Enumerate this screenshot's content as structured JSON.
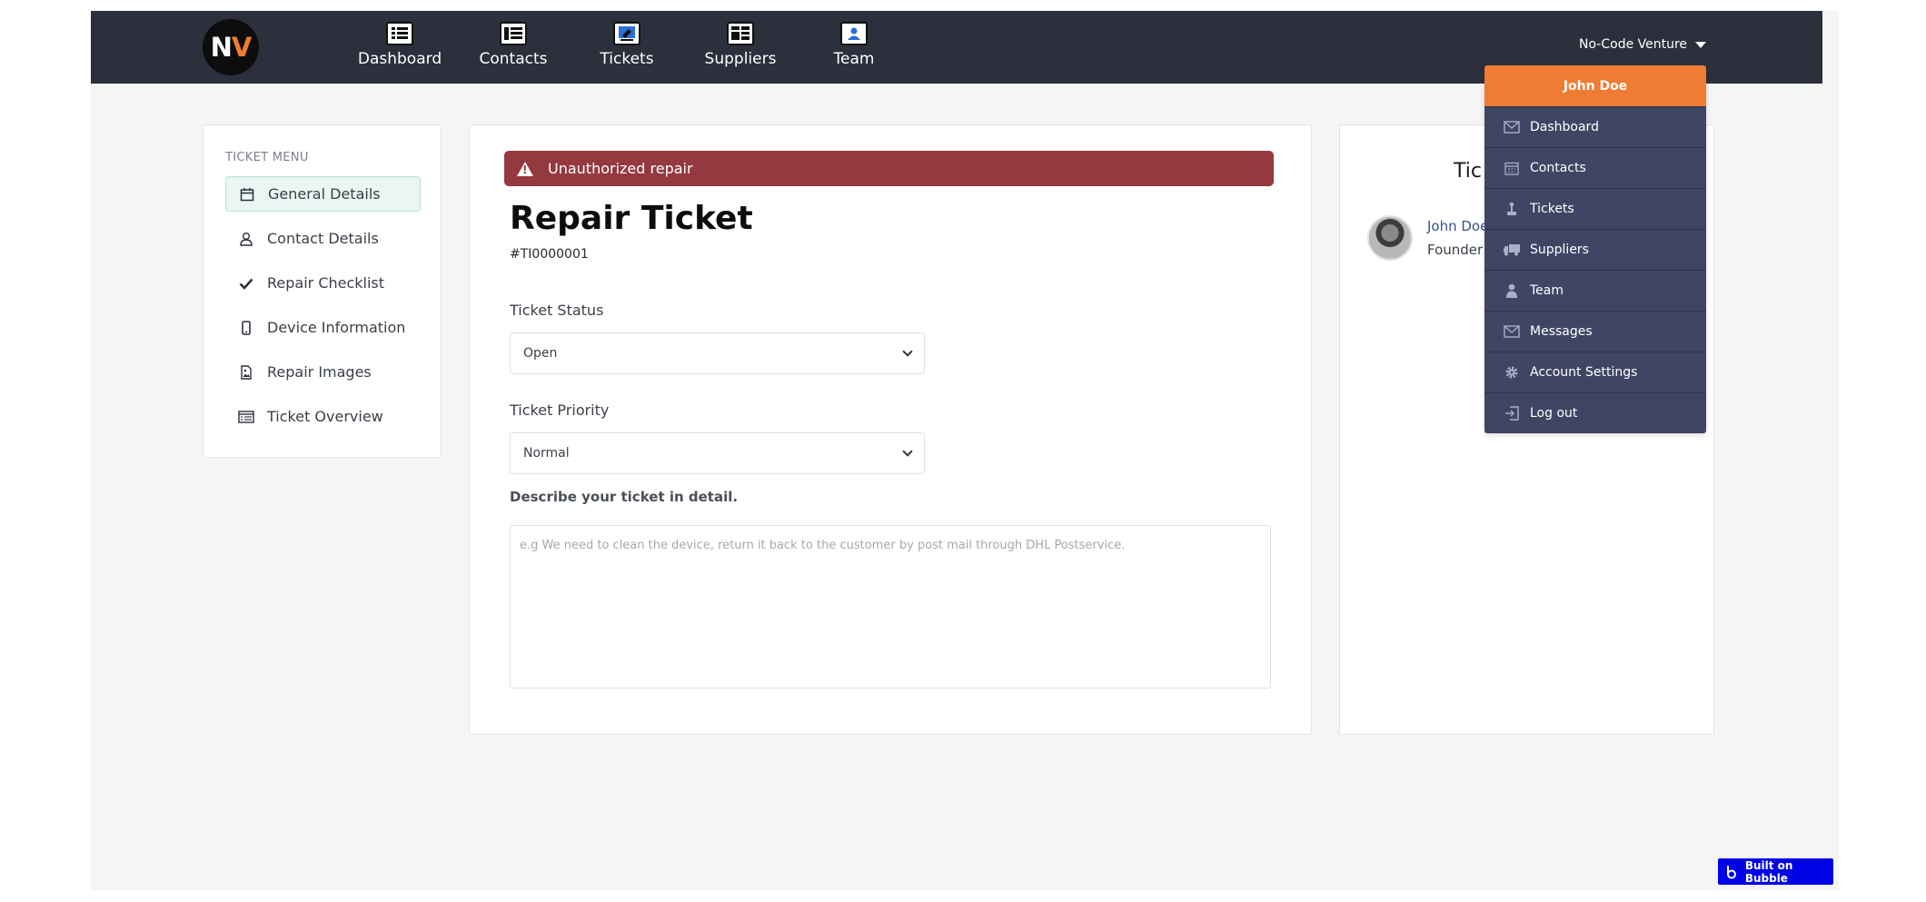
{
  "header": {
    "logo_n": "N",
    "logo_v": "V",
    "nav": [
      {
        "label": "Dashboard",
        "icon": "dashboard-icon"
      },
      {
        "label": "Contacts",
        "icon": "contacts-icon"
      },
      {
        "label": "Tickets",
        "icon": "tickets-icon"
      },
      {
        "label": "Suppliers",
        "icon": "suppliers-icon"
      },
      {
        "label": "Team",
        "icon": "team-icon"
      }
    ],
    "account_label": "No-Code Venture"
  },
  "sidebar": {
    "title": "TICKET MENU",
    "items": [
      {
        "label": "General Details",
        "icon": "calendar-icon",
        "active": true
      },
      {
        "label": "Contact Details",
        "icon": "person-icon"
      },
      {
        "label": "Repair Checklist",
        "icon": "checkmark-icon"
      },
      {
        "label": "Device Information",
        "icon": "phone-icon"
      },
      {
        "label": "Repair Images",
        "icon": "image-icon"
      },
      {
        "label": "Ticket Overview",
        "icon": "list-icon"
      }
    ]
  },
  "main": {
    "alert": "Unauthorized repair",
    "title": "Repair Ticket",
    "ticket_id": "#TI0000001",
    "status_label": "Ticket Status",
    "status_value": "Open",
    "priority_label": "Ticket Priority",
    "priority_value": "Normal",
    "description_label": "Describe your ticket in detail.",
    "description_placeholder": "e.g We need to clean the device, return it back to the customer by post mail through DHL Postservice."
  },
  "right": {
    "title": "Tic",
    "person_name": "John Doe",
    "person_role": "Founder"
  },
  "dropdown": {
    "user": "John Doe",
    "items": [
      {
        "label": "Dashboard",
        "icon": "mail-icon"
      },
      {
        "label": "Contacts",
        "icon": "calendar-icon"
      },
      {
        "label": "Tickets",
        "icon": "joystick-icon"
      },
      {
        "label": "Suppliers",
        "icon": "truck-icon"
      },
      {
        "label": "Team",
        "icon": "person-icon"
      },
      {
        "label": "Messages",
        "icon": "mail-icon"
      },
      {
        "label": "Account Settings",
        "icon": "gear-icon"
      },
      {
        "label": "Log out",
        "icon": "logout-icon"
      }
    ]
  },
  "badge": {
    "label": "Built on Bubble"
  },
  "colors": {
    "topbar": "#2c303d",
    "accent": "#f07c33",
    "alert": "#93393f",
    "dropdown": "#3f4664",
    "bubble": "#0004e6"
  }
}
